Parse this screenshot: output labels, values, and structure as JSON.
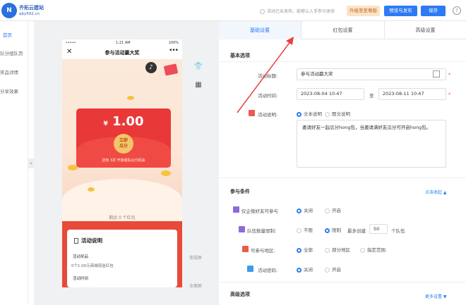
{
  "brand": {
    "logo_text": "N",
    "name": "齐拓云建站",
    "site": "qby592.cn"
  },
  "header": {
    "notice": "活动已未发布，能够认入手参与体验",
    "upgrade_label": "升级至至尊版",
    "preview_label": "预览与发布",
    "save_label": "保存",
    "help_label": "?"
  },
  "sidebar": {
    "items": [
      {
        "label": "首页"
      },
      {
        "label": "队分组队页"
      },
      {
        "label": "奖品详情"
      },
      {
        "label": "分享效果"
      }
    ]
  },
  "phone": {
    "signal": "•••••",
    "time": "1:21 AM",
    "battery": "100%",
    "close": "✕",
    "title": "参与活动赢大奖",
    "more": "•••",
    "amount": "1.00",
    "currency": "¥",
    "open_line1": "立即",
    "open_line2": "瓜分",
    "tip": "还有 3次 开启组队瓜分机会",
    "remaining": "剩余 0 个红包",
    "desc_title": "活动说明",
    "prize_label": "活动奖品",
    "prize_value": "0个1.00元商城现金红包",
    "time_label": "活动时间"
  },
  "canvas_side": {
    "shirt_icon": "👕",
    "grid_icon": "▦",
    "normal_screen": "常规屏",
    "full_screen": "全面屏"
  },
  "tabs": [
    {
      "label": "基础设置"
    },
    {
      "label": "红包设置"
    },
    {
      "label": "高级设置"
    }
  ],
  "basic": {
    "section_title": "基本选项",
    "name_label": "活动标题:",
    "name_value": "参与活动赢大奖",
    "time_label": "活动时间:",
    "start": "2023-08-04 10:47",
    "to": "至",
    "end": "2023-08-11 10:47",
    "desc_label": "活动说明:",
    "desc_text_option": "文本说明",
    "desc_image_option": "图文说明",
    "desc_text": "邀请好友一起瓜分hong包，当邀请满好友瓜分可开启hong包。",
    "required_mark": "*"
  },
  "conditions": {
    "section_title": "参与条件",
    "collapse_link": "点击收起 ▲",
    "rows": [
      {
        "label": "仅企微好友可参与",
        "options": [
          "关闭",
          "开启"
        ]
      },
      {
        "label": "队伍数量限制:",
        "options": [
          "不限",
          "限制",
          "最多创建",
          "个队伍"
        ],
        "count": "50"
      },
      {
        "label": "可参与地区:",
        "options": [
          "全部",
          "部分地区",
          "指定范围"
        ]
      },
      {
        "label": "活动密码:",
        "options": [
          "关闭",
          "开启"
        ]
      }
    ]
  },
  "advanced": {
    "section_title": "高级选项",
    "more_link": "更多设置 ▼"
  },
  "colors": {
    "accent": "#2d7bf4",
    "red": "#e83838",
    "arrow": "#e84040"
  }
}
